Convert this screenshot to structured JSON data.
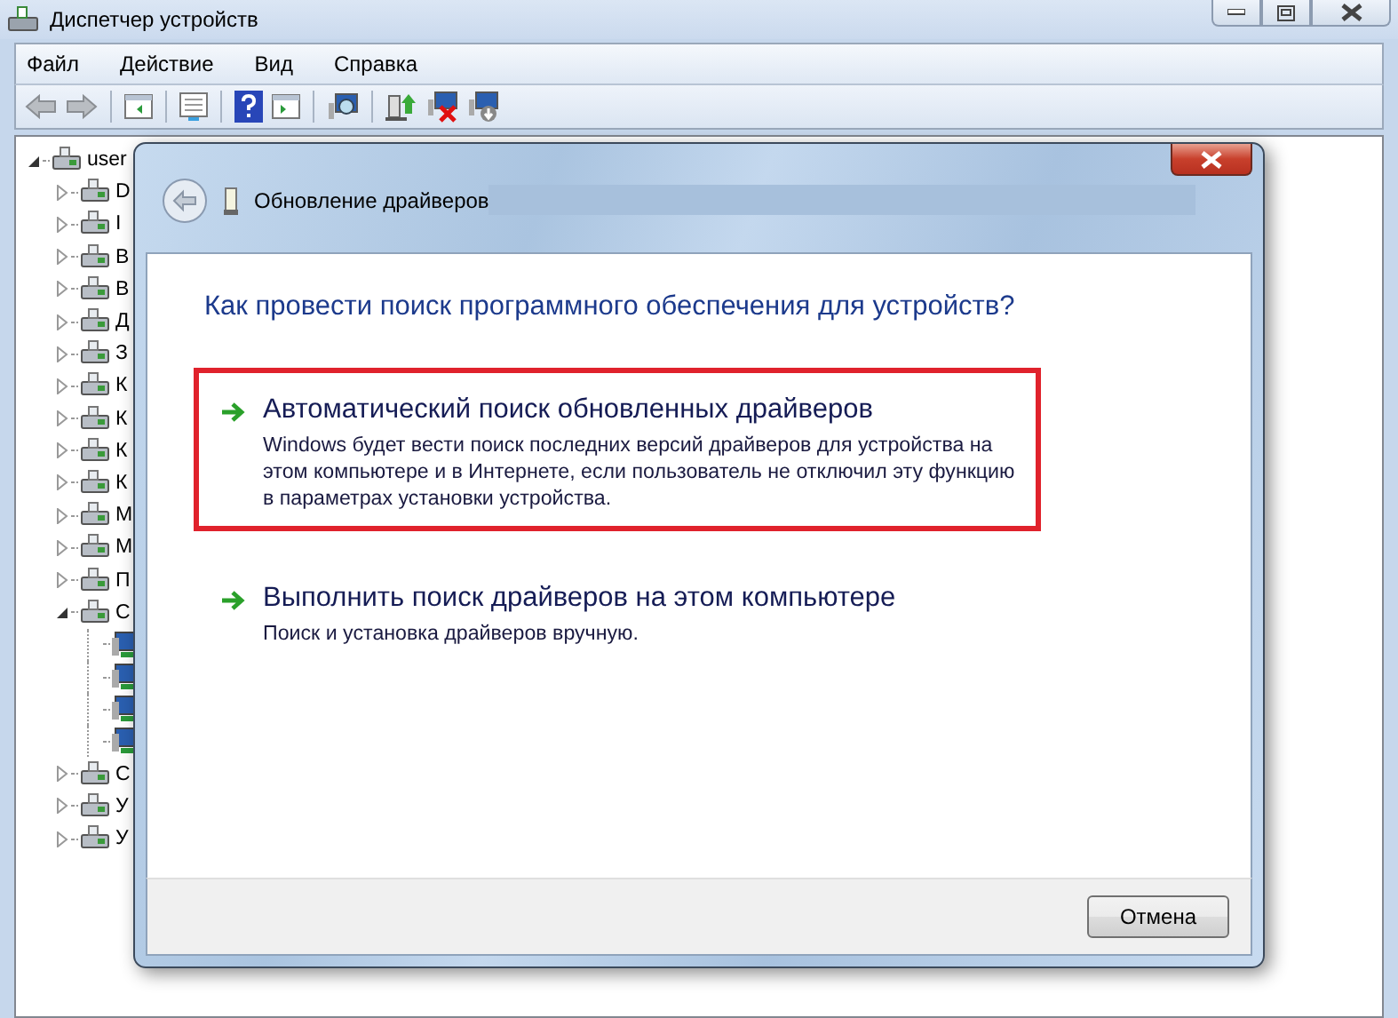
{
  "window": {
    "title": "Диспетчер устройств"
  },
  "menu": [
    "Файл",
    "Действие",
    "Вид",
    "Справка"
  ],
  "tree": {
    "label": "user",
    "expanded": true,
    "children": [
      {
        "label": "D",
        "expanded": false
      },
      {
        "label": "I",
        "expanded": false
      },
      {
        "label": "B",
        "expanded": false
      },
      {
        "label": "B",
        "expanded": false
      },
      {
        "label": "Д",
        "expanded": false
      },
      {
        "label": "З",
        "expanded": false
      },
      {
        "label": "К",
        "expanded": false
      },
      {
        "label": "К",
        "expanded": false
      },
      {
        "label": "К",
        "expanded": false
      },
      {
        "label": "К",
        "expanded": false
      },
      {
        "label": "М",
        "expanded": false
      },
      {
        "label": "М",
        "expanded": false
      },
      {
        "label": "П",
        "expanded": false
      },
      {
        "label": "С",
        "expanded": true,
        "children": [
          {
            "kind": "adapter"
          },
          {
            "kind": "adapter"
          },
          {
            "kind": "adapter"
          },
          {
            "kind": "adapter"
          }
        ]
      },
      {
        "label": "С",
        "expanded": false
      },
      {
        "label": "У",
        "expanded": false
      },
      {
        "label": "У",
        "expanded": false
      }
    ]
  },
  "dialog": {
    "title": "Обновление драйверов",
    "question": "Как провести поиск программного обеспечения для устройств?",
    "options": [
      {
        "title": "Автоматический поиск обновленных драйверов",
        "description": "Windows будет вести поиск последних версий драйверов для устройства на этом компьютере и в Интернете, если пользователь не отключил эту функцию в параметрах установки устройства.",
        "highlighted": true
      },
      {
        "title": "Выполнить поиск драйверов на этом компьютере",
        "description": "Поиск и установка драйверов вручную.",
        "highlighted": false
      }
    ],
    "buttons": [
      "Отмена"
    ]
  }
}
